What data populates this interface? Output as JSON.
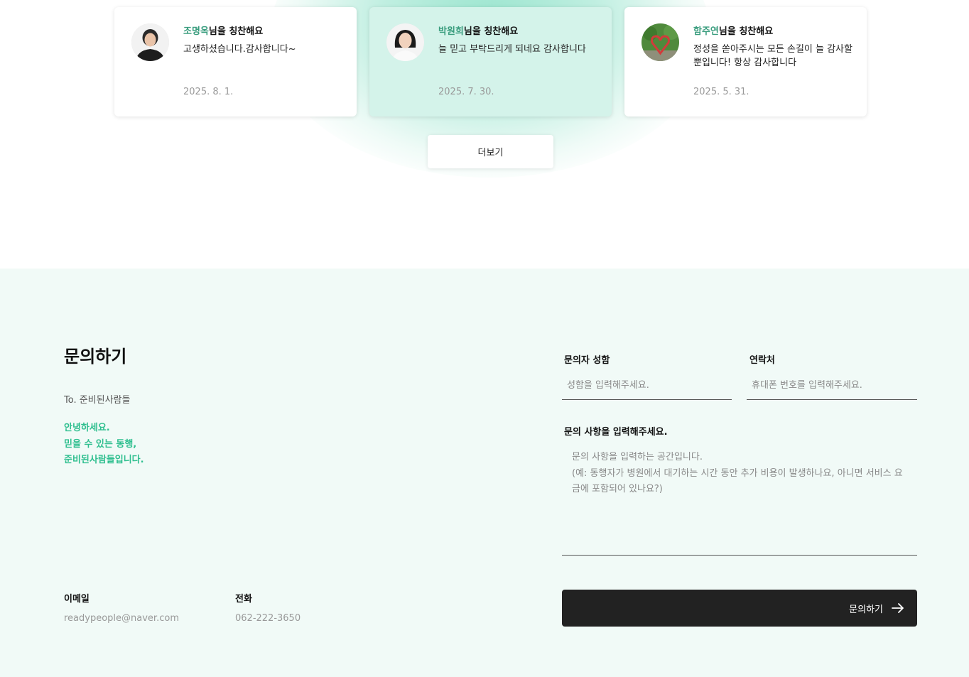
{
  "reviews": [
    {
      "name": "조명옥",
      "suffix": "님을 칭찬해요",
      "message": "고생하셨습니다.감사합니다~",
      "date": "2025. 8. 1."
    },
    {
      "name": "박원희",
      "suffix": "님을 칭찬해요",
      "message": "늘 믿고 부탁드리게 되네요 감사합니다",
      "date": "2025. 7. 30."
    },
    {
      "name": "함주연",
      "suffix": "님을 칭찬해요",
      "message": "정성을 쏟아주시는 모든 손길이 늘 감사할 뿐입니다! 항상 감사합니다",
      "date": "2025. 5. 31."
    }
  ],
  "more_label": "더보기",
  "contact": {
    "title": "문의하기",
    "to": "To. 준비된사람들",
    "greeting": [
      "안녕하세요.",
      "믿을 수 있는 동행,",
      "준비된사람들입니다."
    ],
    "email_label": "이메일",
    "email": "readypeople@naver.com",
    "phone_label": "전화",
    "phone": "062-222-3650"
  },
  "form": {
    "name_label": "문의자 성함",
    "name_placeholder": "성함을 입력해주세요.",
    "phone_label": "연락처",
    "phone_placeholder": "휴대폰 번호를 입력해주세요.",
    "message_label": "문의 사항을 입력해주세요.",
    "message_placeholder": "문의 사항을 입력하는 공간입니다.\n(예: 동행자가 병원에서 대기하는 시간 동안 추가 비용이 발생하나요, 아니면 서비스 요금에 포함되어 있나요?)",
    "submit_label": "문의하기"
  },
  "colors": {
    "accent": "#2fbf8f",
    "name_highlight": "#3a9d7e",
    "dark_button": "#222222",
    "section_bg": "#f1faf7"
  }
}
